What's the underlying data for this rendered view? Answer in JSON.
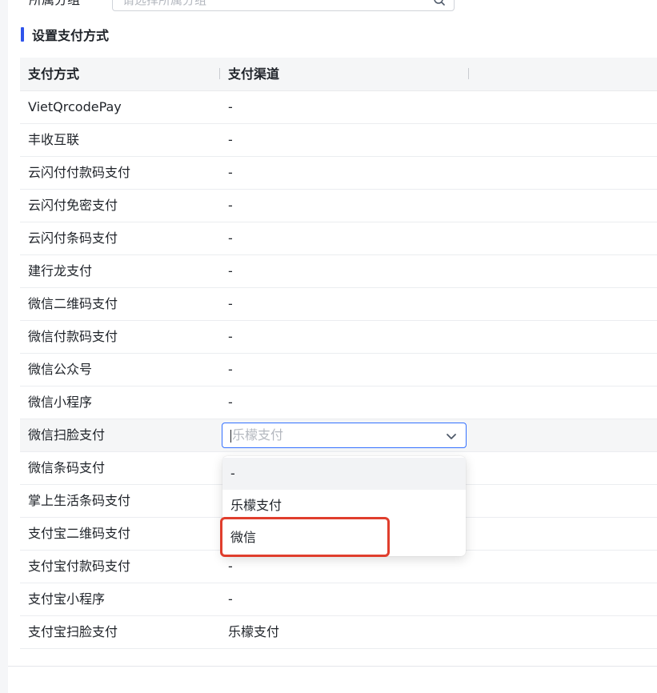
{
  "top_form": {
    "label": "所属分组",
    "placeholder": "请选择所属分组"
  },
  "section": {
    "title": "设置支付方式"
  },
  "table": {
    "headers": {
      "method": "支付方式",
      "channel": "支付渠道"
    },
    "rows": [
      {
        "method": "VietQrcodePay",
        "channel": "-"
      },
      {
        "method": "丰收互联",
        "channel": "-"
      },
      {
        "method": "云闪付付款码支付",
        "channel": "-"
      },
      {
        "method": "云闪付免密支付",
        "channel": "-"
      },
      {
        "method": "云闪付条码支付",
        "channel": "-"
      },
      {
        "method": "建行龙支付",
        "channel": "-"
      },
      {
        "method": "微信二维码支付",
        "channel": "-"
      },
      {
        "method": "微信付款码支付",
        "channel": "-"
      },
      {
        "method": "微信公众号",
        "channel": "-"
      },
      {
        "method": "微信小程序",
        "channel": "-"
      },
      {
        "method": "微信扫脸支付",
        "channel": "乐檬支付"
      },
      {
        "method": "微信条码支付",
        "channel": "-"
      },
      {
        "method": "掌上生活条码支付",
        "channel": "-"
      },
      {
        "method": "支付宝二维码支付",
        "channel": "-"
      },
      {
        "method": "支付宝付款码支付",
        "channel": "-"
      },
      {
        "method": "支付宝小程序",
        "channel": "-"
      },
      {
        "method": "支付宝扫脸支付",
        "channel": "乐檬支付"
      }
    ]
  },
  "dropdown": {
    "options": [
      "-",
      "乐檬支付",
      "微信"
    ],
    "highlighted_option": "微信"
  },
  "colors": {
    "accent": "#3370ff",
    "section_bar": "#2f54eb",
    "highlight_box": "#e03e2d"
  }
}
